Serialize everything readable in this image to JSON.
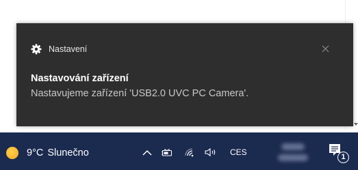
{
  "notification": {
    "app_name": "Nastavení",
    "title": "Nastavování zařízení",
    "body": "Nastavujeme zařízení 'USB2.0 UVC PC Camera'.",
    "icon": "gear-icon",
    "close_icon": "close-icon"
  },
  "taskbar": {
    "weather": {
      "temperature": "9°C",
      "condition": "Slunečno",
      "icon": "sun-icon"
    },
    "tray_icons": [
      "chevron-up-icon",
      "battery-icon",
      "wifi-icon",
      "speaker-icon"
    ],
    "language": "CES",
    "notification_count": "1"
  },
  "colors": {
    "toast_background": "#2e2e2e",
    "taskbar_background": "#1b2a4f",
    "sun": "#f5a623"
  }
}
